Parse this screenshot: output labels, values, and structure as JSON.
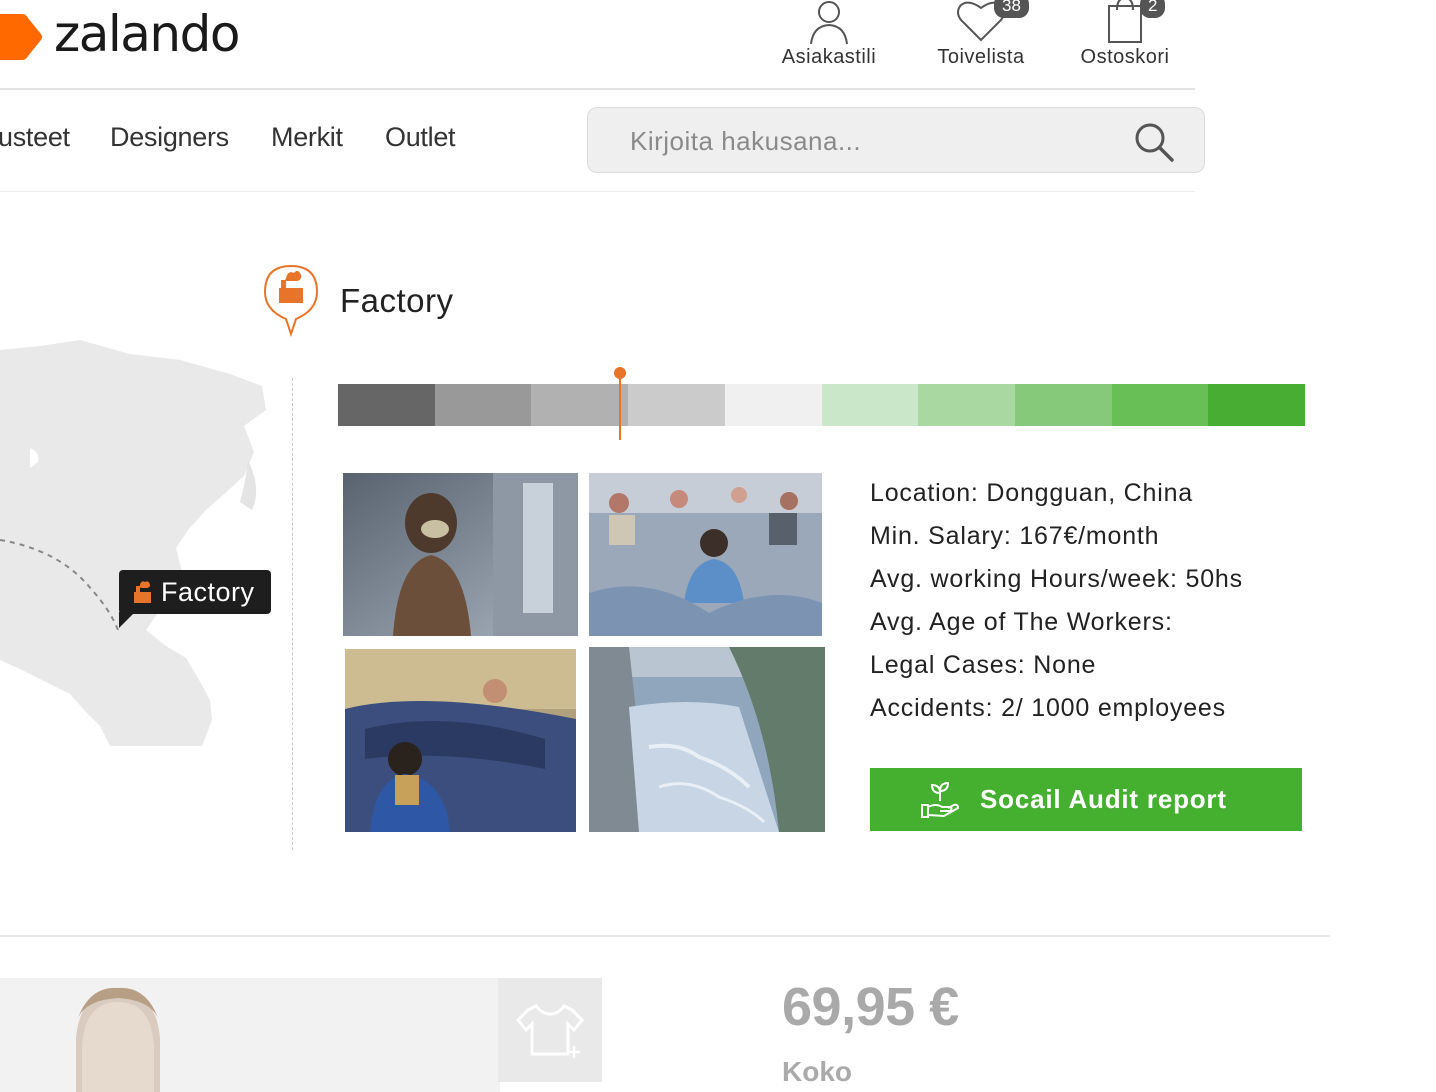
{
  "header": {
    "logo": "zalando",
    "account_label": "Asiakastili",
    "wishlist_label": "Toivelista",
    "wishlist_count": "38",
    "cart_label": "Ostoskori",
    "cart_count": "2"
  },
  "nav": {
    "items": [
      "usteet",
      "Designers",
      "Merkit",
      "Outlet"
    ]
  },
  "search": {
    "placeholder": "Kirjoita hakusana..."
  },
  "factory": {
    "title": "Factory",
    "map_label": "Factory",
    "scale_colors": [
      "#666666",
      "#999999",
      "#b1b1b1",
      "#cbcbcb",
      "#f0f0f0",
      "#cbe7c9",
      "#a9d9a0",
      "#86c97b",
      "#67bf55",
      "#48ad33"
    ],
    "scale_marker_fraction": 0.292,
    "info": [
      "Location: Dongguan, China",
      "Min. Salary: 167€/month",
      "Avg. working Hours/week: 50hs",
      "Avg. Age of The Workers:",
      "Legal Cases: None",
      "Accidents: 2/ 1000 employees"
    ],
    "audit_button": "Socail Audit report",
    "accent_color": "#e8742a",
    "button_color": "#45af2f"
  },
  "product": {
    "price": "69,95 €",
    "size_label": "Koko"
  }
}
